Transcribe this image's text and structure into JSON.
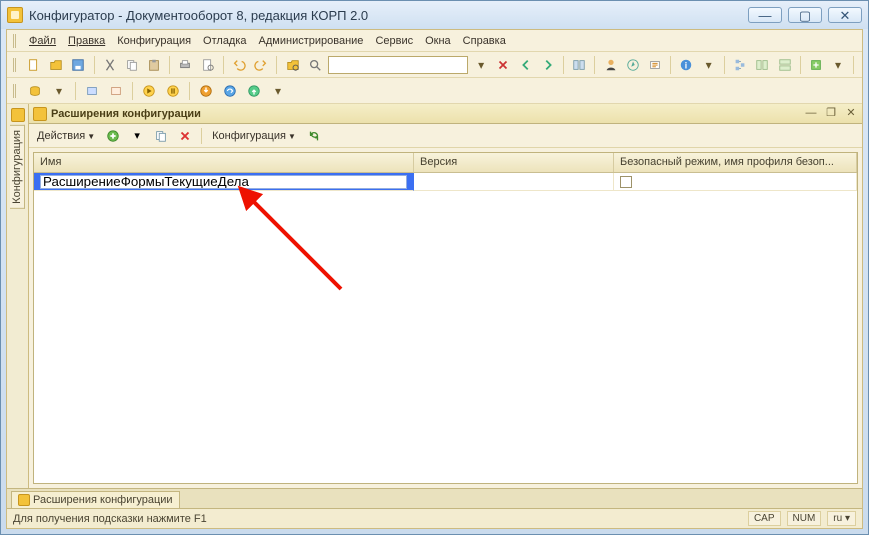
{
  "window": {
    "title": "Конфигуратор - Документооборот 8, редакция КОРП 2.0"
  },
  "menu": {
    "items": [
      "Файл",
      "Правка",
      "Конфигурация",
      "Отладка",
      "Администрирование",
      "Сервис",
      "Окна",
      "Справка"
    ]
  },
  "sidetab": {
    "label": "Конфигурация"
  },
  "panel": {
    "title": "Расширения конфигурации",
    "toolbar": {
      "actions": "Действия",
      "config": "Конфигурация"
    },
    "columns": {
      "name": "Имя",
      "version": "Версия",
      "safe": "Безопасный режим, имя профиля безоп..."
    },
    "row": {
      "name": "РасширениеФормыТекущиеДела",
      "version": "",
      "safe_checked": false
    }
  },
  "bottomTab": {
    "label": "Расширения конфигурации"
  },
  "status": {
    "hint": "Для получения подсказки нажмите F1",
    "cap": "CAP",
    "num": "NUM",
    "lang": "ru"
  }
}
